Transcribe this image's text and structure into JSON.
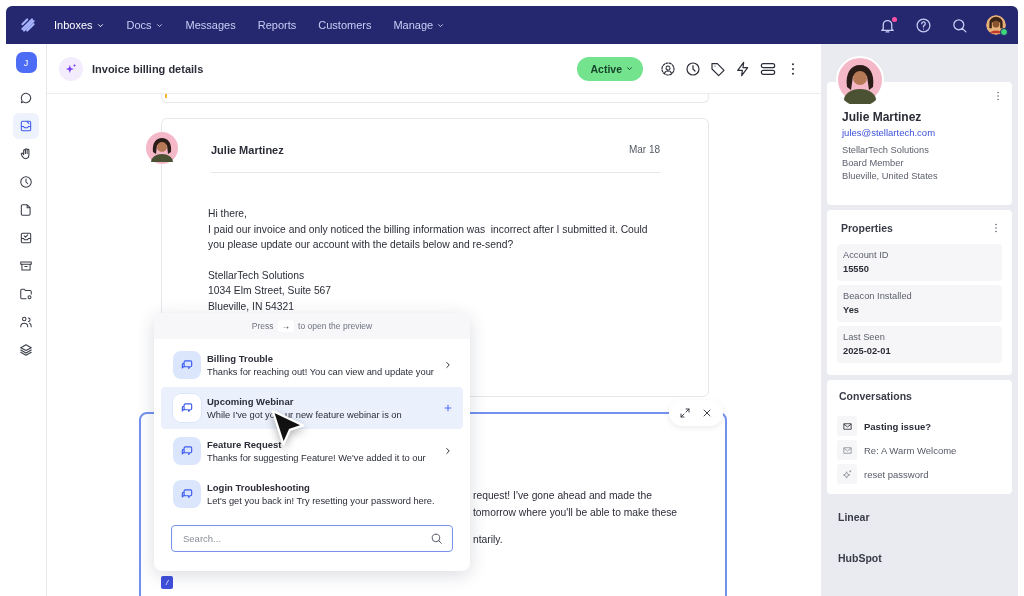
{
  "nav": {
    "items": [
      {
        "label": "Inboxes",
        "dropdown": true,
        "selected": true
      },
      {
        "label": "Docs",
        "dropdown": true,
        "selected": false
      },
      {
        "label": "Messages",
        "dropdown": false,
        "selected": false
      },
      {
        "label": "Reports",
        "dropdown": false,
        "selected": false
      },
      {
        "label": "Customers",
        "dropdown": false,
        "selected": false
      },
      {
        "label": "Manage",
        "dropdown": true,
        "selected": false
      }
    ],
    "notifications_unread": true,
    "user_online": true
  },
  "sidebar": {
    "user_initial": "J",
    "items": [
      {
        "kind": "chat",
        "selected": false
      },
      {
        "kind": "inbox",
        "selected": true
      },
      {
        "kind": "hand",
        "selected": false
      },
      {
        "kind": "clock",
        "selected": false
      },
      {
        "kind": "document",
        "selected": false
      },
      {
        "kind": "inbox-check",
        "selected": false
      },
      {
        "kind": "archive",
        "selected": false
      },
      {
        "kind": "folder-settings",
        "selected": false
      },
      {
        "kind": "people",
        "selected": false
      },
      {
        "kind": "layers",
        "selected": false
      }
    ]
  },
  "conversation": {
    "title": "Invoice billing details",
    "status": "Active",
    "message": {
      "author": "Julie Martinez",
      "date": "Mar 18",
      "paragraphs": [
        [
          "Hi there,",
          "I paid our invoice and only noticed the billing information was  incorrect after I submitted it. Could you please update our account with the details below and re-send?"
        ],
        [
          "StellarTech Solutions",
          "1034 Elm Street, Suite 567",
          "Blueville, IN 54321"
        ]
      ]
    },
    "reply": {
      "paragraphs": [
        [
          "request! I've gone ahead and made the",
          "tomorrow where you'll be able to make these"
        ],
        [
          "ntarily."
        ]
      ],
      "trigger_key": "/"
    }
  },
  "saved_replies": {
    "hint_before": "Press",
    "hint_key": "→",
    "hint_after": "to open the preview",
    "items": [
      {
        "title": "Billing Trouble",
        "preview": [
          "Thanks for reaching out! You can view and update your"
        ],
        "kind": "open",
        "selected": false
      },
      {
        "title": "Upcoming Webinar",
        "preview": [
          "While I've got yo",
          "ur new feature webinar is on"
        ],
        "kind": "insert",
        "selected": true
      },
      {
        "title": "Feature Request",
        "preview": [
          "Thanks for suggesting Feature! We've added it to our"
        ],
        "kind": "open",
        "selected": false
      },
      {
        "title": "Login Troubleshooting",
        "preview": [
          "Let's get you back in! Try resetting your password here."
        ],
        "kind": "plain",
        "selected": false
      }
    ],
    "search": {
      "placeholder": "Search..."
    }
  },
  "customer": {
    "name": "Julie Martinez",
    "email": "jules@stellartech.com",
    "details": [
      "StellarTech Solutions",
      "Board Member",
      "Blueville, United States"
    ],
    "properties_title": "Properties",
    "properties": [
      {
        "label": "Account ID",
        "value": "15550"
      },
      {
        "label": "Beacon Installed",
        "value": "Yes"
      },
      {
        "label": "Last Seen",
        "value": "2025-02-01"
      }
    ],
    "conversations_title": "Conversations",
    "conversations": [
      {
        "kind": "mail",
        "title": "Pasting issue?",
        "unread": true
      },
      {
        "kind": "mail",
        "title": "Re: A Warm Welcome",
        "unread": false
      },
      {
        "kind": "sparkle",
        "title": "reset password",
        "unread": false
      }
    ],
    "integrations": [
      "Linear",
      "HubSpot"
    ]
  }
}
